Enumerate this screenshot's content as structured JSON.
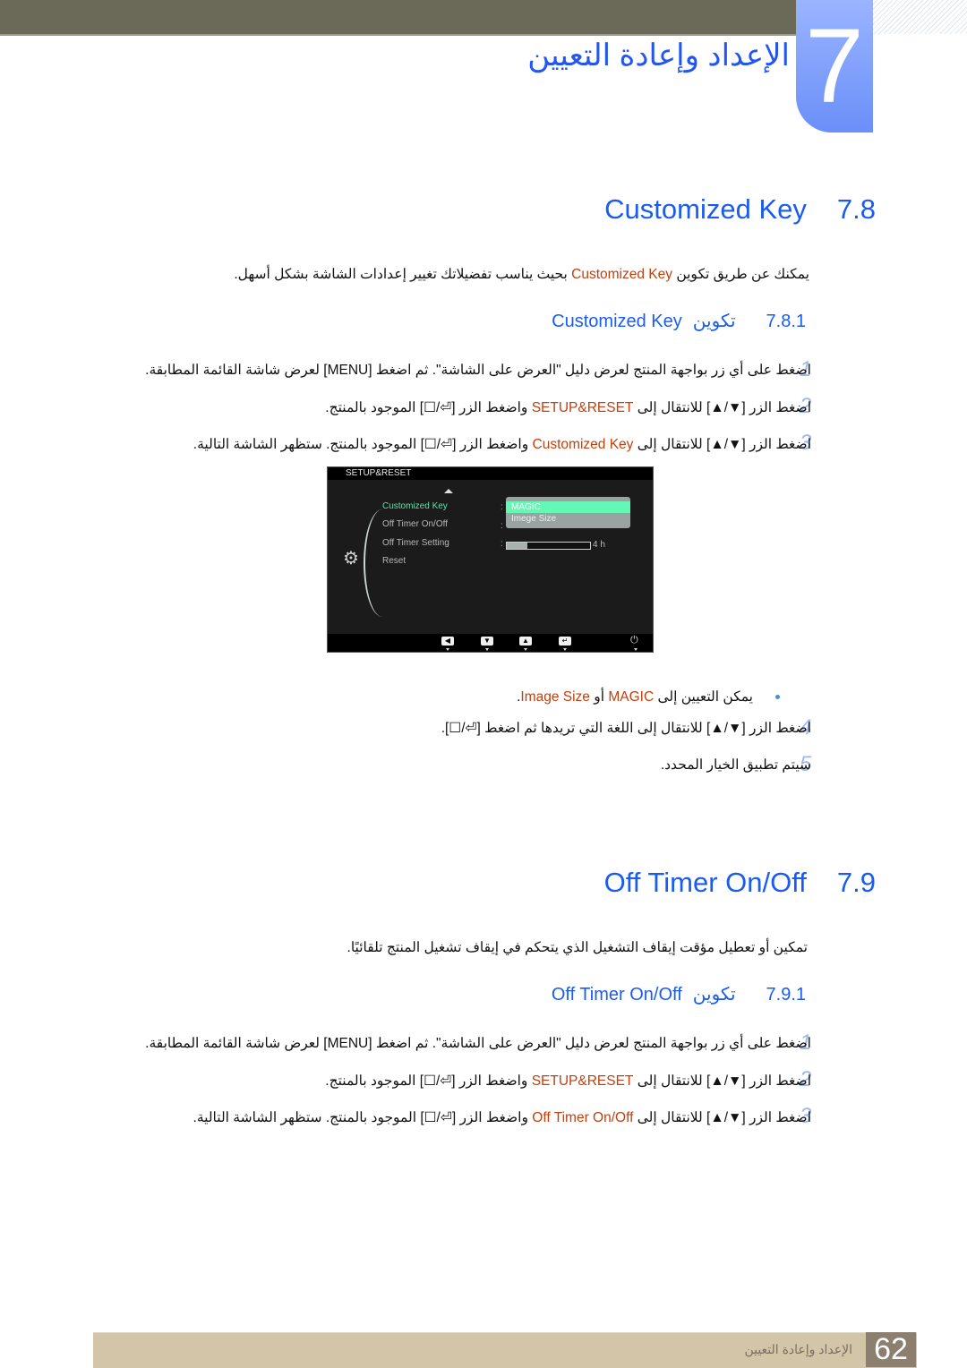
{
  "chapter": {
    "number": "7",
    "title": "الإعداد وإعادة التعيين"
  },
  "section_78": {
    "number": "7.8",
    "title": "Customized Key",
    "intro_before": "يمكنك عن طريق تكوين ",
    "intro_hl": "Customized Key",
    "intro_after": " بحيث يناسب تفضيلاتك تغيير إعدادات الشاشة بشكل أسهل.",
    "sub": {
      "number": "7.8.1",
      "title_ar": "تكوين",
      "title_en": "Customized Key"
    },
    "steps": [
      {
        "num": "1",
        "text": "اضغط على أي زر بواجهة المنتج لعرض دليل \"العرض على الشاشة\". ثم اضغط [MENU] لعرض شاشة القائمة المطابقة."
      },
      {
        "num": "2",
        "before": "اضغط الزر [▼/▲] للانتقال إلى ",
        "hl": "SETUP&RESET",
        "after": " واضغط الزر [⏎/☐] الموجود بالمنتج."
      },
      {
        "num": "3",
        "before": "اضغط الزر [▼/▲] للانتقال إلى ",
        "hl": "Customized Key",
        "after": " واضغط الزر [⏎/☐] الموجود بالمنتج. ستظهر الشاشة التالية."
      },
      {
        "num": "4",
        "text": "اضغط الزر [▼/▲] للانتقال إلى اللغة التي تريدها ثم اضغط [⏎/☐]."
      },
      {
        "num": "5",
        "text": "سيتم تطبيق الخيار المحدد."
      }
    ],
    "bullet": {
      "before": "يمكن التعيين إلى ",
      "hl1": "MAGIC",
      "mid": " أو ",
      "hl2": "Image Size",
      "after": "."
    }
  },
  "osd": {
    "header": "SETUP&RESET",
    "items": [
      "Customized Key",
      "Off Timer On/Off",
      "Off Timer Setting",
      "Reset"
    ],
    "selected_index": 0,
    "dropdown_options": [
      "MAGIC",
      "Imege Size"
    ],
    "dropdown_selected": "MAGIC",
    "timer_fraction": 0.25,
    "timer_label": "4 h",
    "footer_keys": [
      "◀",
      "▼",
      "▲",
      "↵"
    ],
    "power_glyph": "⏻"
  },
  "section_79": {
    "number": "7.9",
    "title": "Off Timer On/Off",
    "intro": "تمكين أو تعطيل مؤقت إيقاف التشغيل الذي يتحكم في إيقاف تشغيل المنتج تلقائيًا.",
    "sub": {
      "number": "7.9.1",
      "title_ar": "تكوين",
      "title_en": "Off Timer On/Off"
    },
    "steps": [
      {
        "num": "1",
        "text": "اضغط على أي زر بواجهة المنتج لعرض دليل \"العرض على الشاشة\". ثم اضغط [MENU] لعرض شاشة القائمة المطابقة."
      },
      {
        "num": "2",
        "before": "اضغط الزر [▼/▲] للانتقال إلى ",
        "hl": "SETUP&RESET",
        "after": " واضغط الزر [⏎/☐] الموجود بالمنتج."
      },
      {
        "num": "3",
        "before": "اضغط الزر [▼/▲] للانتقال إلى ",
        "hl": "Off Timer On/Off",
        "after": " واضغط الزر [⏎/☐] الموجود بالمنتج. ستظهر الشاشة التالية."
      }
    ]
  },
  "footer": {
    "page_number": "62",
    "chapter_title": "الإعداد وإعادة التعيين"
  }
}
